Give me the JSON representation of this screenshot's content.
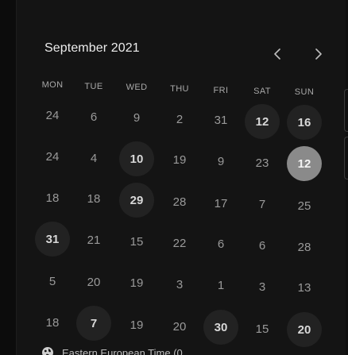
{
  "calendar": {
    "month_label": "September 2021",
    "prev_icon": "chevron-left-icon",
    "next_icon": "chevron-right-icon",
    "weekdays": [
      "MON",
      "TUE",
      "WED",
      "THU",
      "FRI",
      "SAT",
      "SUN"
    ],
    "weeks": [
      [
        {
          "label": "24",
          "state": "plain"
        },
        {
          "label": "6",
          "state": "plain"
        },
        {
          "label": "9",
          "state": "plain"
        },
        {
          "label": "2",
          "state": "plain"
        },
        {
          "label": "31",
          "state": "plain"
        },
        {
          "label": "12",
          "state": "available"
        },
        {
          "label": "16",
          "state": "available"
        }
      ],
      [
        {
          "label": "24",
          "state": "plain"
        },
        {
          "label": "4",
          "state": "plain"
        },
        {
          "label": "10",
          "state": "available"
        },
        {
          "label": "19",
          "state": "plain"
        },
        {
          "label": "9",
          "state": "plain"
        },
        {
          "label": "23",
          "state": "plain"
        },
        {
          "label": "12",
          "state": "selected"
        }
      ],
      [
        {
          "label": "18",
          "state": "plain"
        },
        {
          "label": "18",
          "state": "plain"
        },
        {
          "label": "29",
          "state": "available"
        },
        {
          "label": "28",
          "state": "plain"
        },
        {
          "label": "17",
          "state": "plain"
        },
        {
          "label": "7",
          "state": "plain"
        },
        {
          "label": "25",
          "state": "plain"
        }
      ],
      [
        {
          "label": "31",
          "state": "available"
        },
        {
          "label": "21",
          "state": "plain"
        },
        {
          "label": "15",
          "state": "plain"
        },
        {
          "label": "22",
          "state": "plain"
        },
        {
          "label": "6",
          "state": "plain"
        },
        {
          "label": "6",
          "state": "plain"
        },
        {
          "label": "28",
          "state": "plain"
        }
      ],
      [
        {
          "label": "5",
          "state": "plain"
        },
        {
          "label": "20",
          "state": "plain"
        },
        {
          "label": "19",
          "state": "plain"
        },
        {
          "label": "3",
          "state": "plain"
        },
        {
          "label": "1",
          "state": "plain"
        },
        {
          "label": "3",
          "state": "plain"
        },
        {
          "label": "13",
          "state": "plain"
        }
      ],
      [
        {
          "label": "18",
          "state": "plain"
        },
        {
          "label": "7",
          "state": "available"
        },
        {
          "label": "19",
          "state": "plain"
        },
        {
          "label": "20",
          "state": "plain"
        },
        {
          "label": "30",
          "state": "available"
        },
        {
          "label": "15",
          "state": "plain"
        },
        {
          "label": "20",
          "state": "available"
        }
      ]
    ]
  },
  "timezone": {
    "icon": "globe-icon",
    "label": "Eastern European Time (0..."
  }
}
